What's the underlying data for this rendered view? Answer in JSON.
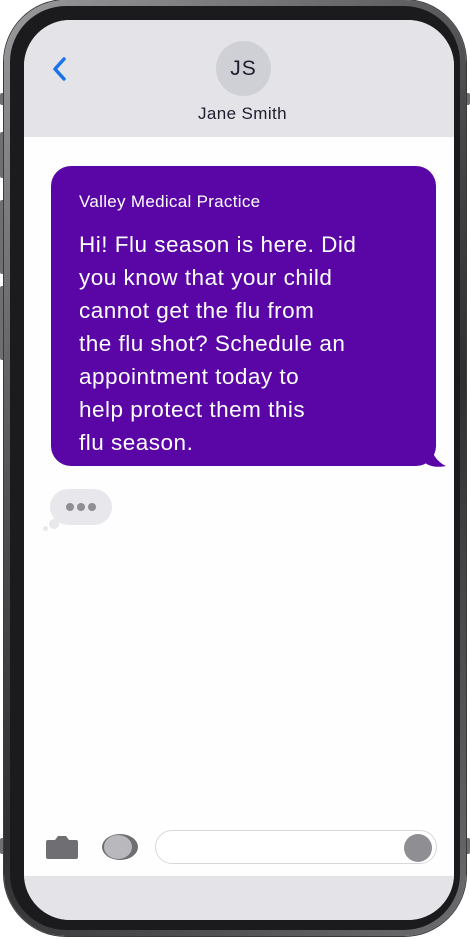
{
  "header": {
    "back_icon": "chevron-left-icon",
    "avatar_initials": "JS",
    "contact_name": "Jane Smith"
  },
  "message": {
    "sender": "Valley Medical Practice",
    "text": "Hi! Flu season is here. Did\nyou know that your child\ncannot get the flu from\nthe flu shot? Schedule an\nappointment today to\nhelp protect them this\nflu season.",
    "bubble_color": "#5a06a6"
  },
  "typing_indicator": {
    "icon": "typing-dots-icon"
  },
  "compose": {
    "camera_icon": "camera-icon",
    "apps_icon": "app-store-icon",
    "input_value": "",
    "input_placeholder": "",
    "send_icon": "send-icon"
  },
  "colors": {
    "header_bg": "#e4e4e8",
    "accent_blue": "#1a73e8",
    "bubble_purple": "#5a06a6"
  }
}
